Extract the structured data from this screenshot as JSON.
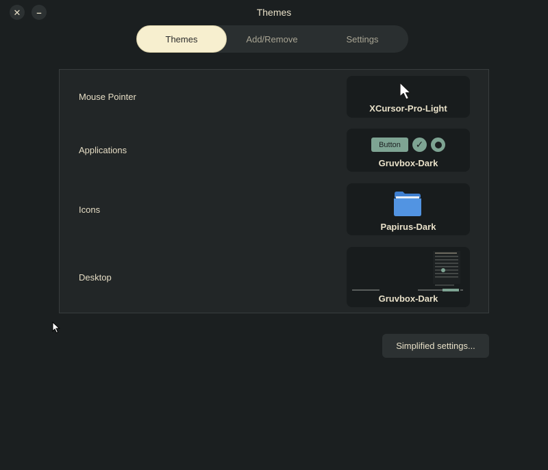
{
  "window": {
    "title": "Themes",
    "close_glyph": "✕",
    "minimize_glyph": "–"
  },
  "tabs": [
    {
      "label": "Themes",
      "active": true
    },
    {
      "label": "Add/Remove",
      "active": false
    },
    {
      "label": "Settings",
      "active": false
    }
  ],
  "themes": {
    "mouse_pointer": {
      "label": "Mouse Pointer",
      "value": "XCursor-Pro-Light",
      "icon": "cursor-arrow-icon"
    },
    "applications": {
      "label": "Applications",
      "value": "Gruvbox-Dark",
      "preview_button_label": "Button",
      "preview_check_glyph": "✓"
    },
    "icons": {
      "label": "Icons",
      "value": "Papirus-Dark",
      "icon": "folder-icon"
    },
    "desktop": {
      "label": "Desktop",
      "value": "Gruvbox-Dark"
    }
  },
  "footer": {
    "simplified_settings_label": "Simplified settings..."
  },
  "colors": {
    "background": "#1b1f20",
    "accent": "#7ea493",
    "active_tab": "#f7efcf",
    "folder_blue": "#5294e2"
  }
}
